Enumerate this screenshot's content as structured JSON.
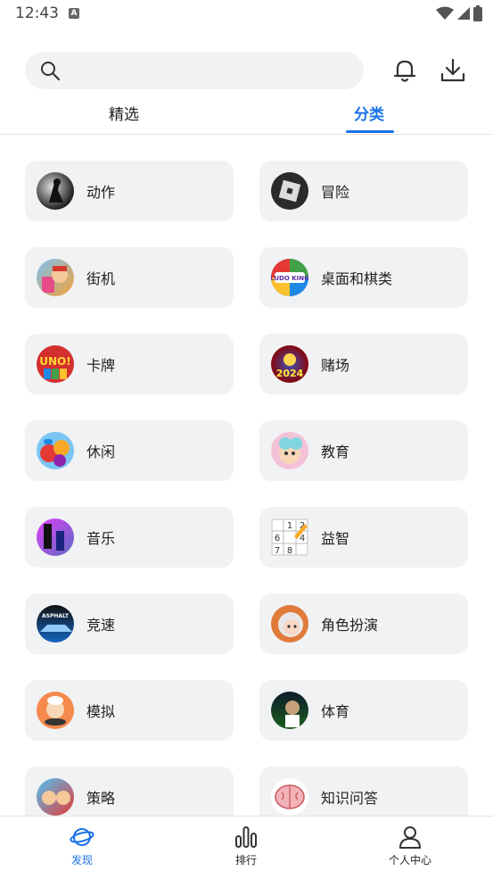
{
  "status": {
    "time": "12:43",
    "badge": "A"
  },
  "search": {
    "placeholder": ""
  },
  "tabs": [
    {
      "label": "精选"
    },
    {
      "label": "分类"
    }
  ],
  "categories": [
    {
      "label": "动作",
      "icon": "action-game-icon"
    },
    {
      "label": "冒险",
      "icon": "roblox-icon"
    },
    {
      "label": "街机",
      "icon": "subway-surfers-icon"
    },
    {
      "label": "桌面和棋类",
      "icon": "ludo-king-icon",
      "icon_text": "LUDO KING"
    },
    {
      "label": "卡牌",
      "icon": "uno-icon",
      "icon_text": "UNO!"
    },
    {
      "label": "赌场",
      "icon": "casino-icon",
      "icon_text": "2024"
    },
    {
      "label": "休闲",
      "icon": "candy-crush-icon"
    },
    {
      "label": "教育",
      "icon": "toca-world-icon"
    },
    {
      "label": "音乐",
      "icon": "piano-tiles-icon"
    },
    {
      "label": "益智",
      "icon": "sudoku-icon",
      "icon_text": [
        "1",
        "2",
        "",
        "6",
        "",
        "4",
        "7",
        "8",
        ""
      ]
    },
    {
      "label": "竞速",
      "icon": "asphalt-icon",
      "icon_text": "ASPHALT"
    },
    {
      "label": "角色扮演",
      "icon": "anime-character-icon"
    },
    {
      "label": "模拟",
      "icon": "cooking-game-icon"
    },
    {
      "label": "体育",
      "icon": "fc-football-icon"
    },
    {
      "label": "策略",
      "icon": "strategy-game-icon"
    },
    {
      "label": "知识问答",
      "icon": "brain-test-icon"
    }
  ],
  "bottom_nav": [
    {
      "label": "发现",
      "icon": "planet-icon",
      "active": true
    },
    {
      "label": "排行",
      "icon": "bar-chart-icon",
      "active": false
    },
    {
      "label": "个人中心",
      "icon": "person-icon",
      "active": false
    }
  ],
  "colors": {
    "accent": "#1a73e8",
    "card_bg": "#f1f2f4"
  }
}
